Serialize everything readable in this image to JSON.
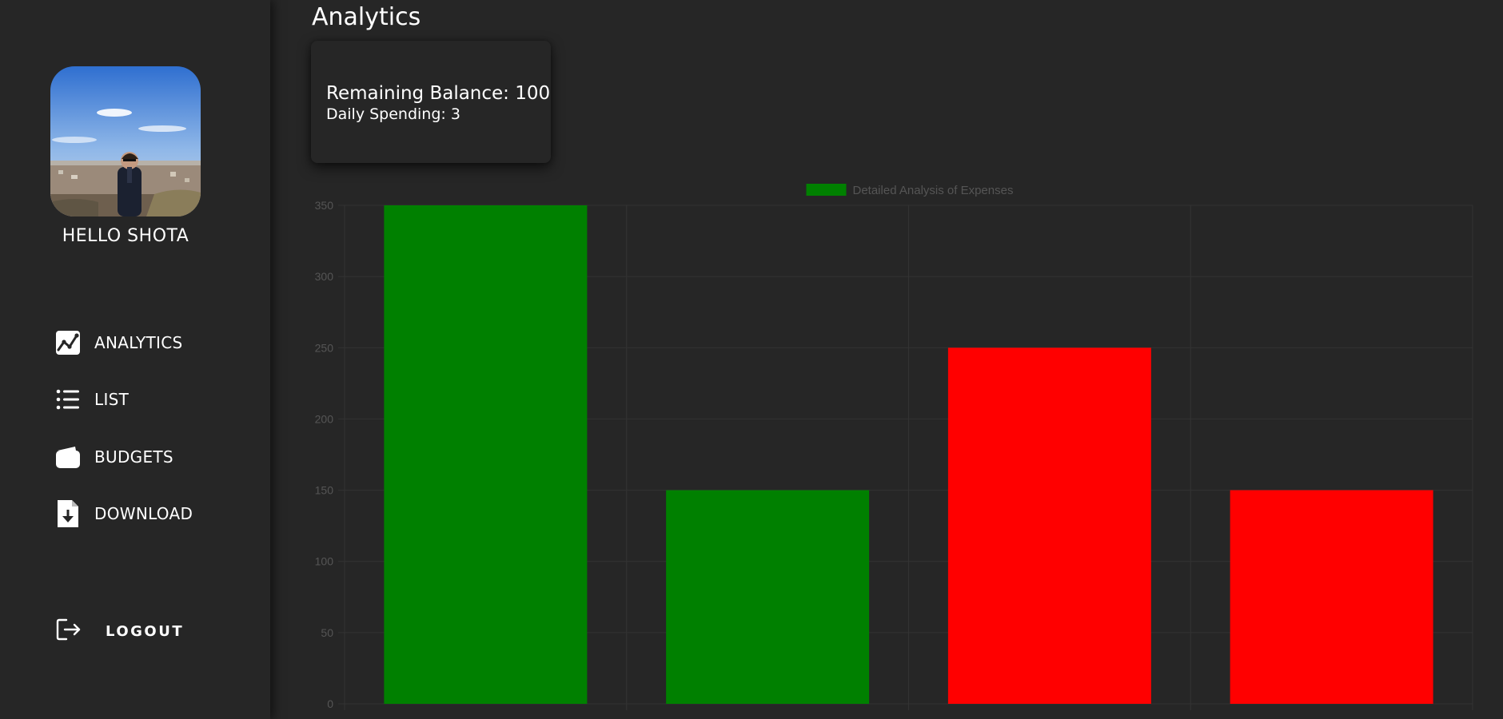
{
  "sidebar": {
    "greeting": "HELLO SHOTA",
    "nav": [
      {
        "label": "ANALYTICS",
        "icon": "analytics-chart-icon"
      },
      {
        "label": "LIST",
        "icon": "list-icon"
      },
      {
        "label": "BUDGETS",
        "icon": "wallet-icon"
      },
      {
        "label": "DOWNLOAD",
        "icon": "file-download-icon"
      }
    ],
    "logout_label": "LOGOUT"
  },
  "main": {
    "title": "Analytics",
    "balance_text": "Remaining Balance: 100",
    "daily_text": "Daily Spending: 3"
  },
  "colors": {
    "background": "#262626",
    "income": "#008000",
    "expense": "#ff0000",
    "grid": "#333333",
    "tick_text": "#555555"
  },
  "chart_data": {
    "type": "bar",
    "categories": [
      "",
      "",
      "",
      ""
    ],
    "values": [
      350,
      150,
      250,
      150
    ],
    "bar_colors": [
      "#008000",
      "#008000",
      "#ff0000",
      "#ff0000"
    ],
    "legend": [
      "Detailed Analysis of Expenses"
    ],
    "legend_position": "top",
    "ylim": [
      0,
      350
    ],
    "yticks": [
      0,
      50,
      100,
      150,
      200,
      250,
      300,
      350
    ],
    "grid": true
  }
}
